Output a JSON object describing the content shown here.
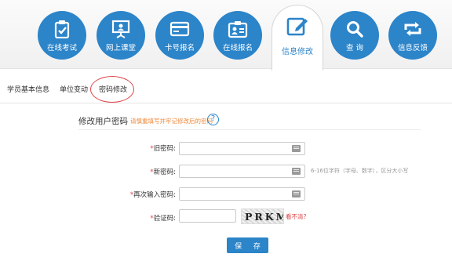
{
  "nav": {
    "items": [
      {
        "label": "在线考试",
        "icon": "exam-clipboard-icon"
      },
      {
        "label": "网上课堂",
        "icon": "online-classroom-icon"
      },
      {
        "label": "卡号报名",
        "icon": "card-register-icon"
      },
      {
        "label": "在线报名",
        "icon": "online-register-icon"
      },
      {
        "label": "信息修改",
        "icon": "edit-info-icon"
      },
      {
        "label": "查 询",
        "icon": "search-icon"
      },
      {
        "label": "信息反馈",
        "icon": "feedback-icon"
      }
    ],
    "active_index": 4,
    "color": "#2c84c9"
  },
  "subtabs": [
    {
      "label": "学员基本信息"
    },
    {
      "label": "单位变动"
    },
    {
      "label": "密码修改"
    }
  ],
  "form": {
    "title": "修改用户密码",
    "hint": "请慎重填写并牢记修改后的密码",
    "help_symbol": "?",
    "fields": [
      {
        "required": "*",
        "label": "旧密码:",
        "value": ""
      },
      {
        "required": "*",
        "label": "新密码:",
        "value": "",
        "note": "6-16位字符（字母、数字），区分大小写"
      },
      {
        "required": "*",
        "label": "再次输入密码:",
        "value": ""
      }
    ],
    "captcha": {
      "required": "*",
      "label": "验证码:",
      "value": "",
      "image_text": "PRKM",
      "refresh_link": "看不清?"
    },
    "save_label": "保 存"
  },
  "colors": {
    "accent": "#2c84c9",
    "required": "#e0454a",
    "hint": "#f08a3c"
  }
}
